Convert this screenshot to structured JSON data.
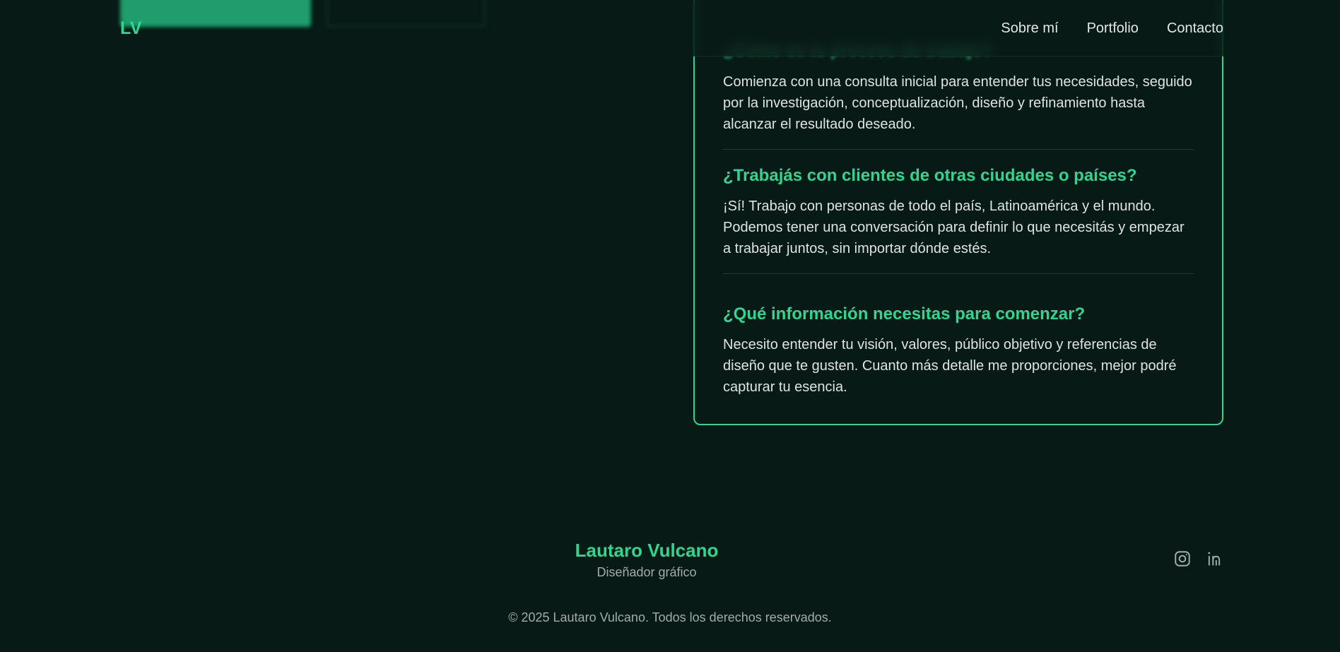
{
  "header": {
    "logo": "LV",
    "nav": [
      "Sobre mí",
      "Portfolio",
      "Contacto"
    ]
  },
  "faq": {
    "partial_question": "¿Cómo es tu proceso de trabajo?",
    "items": [
      {
        "answer": "Comienza con una consulta inicial para entender tus necesidades, seguido por la investigación, conceptualización, diseño y refinamiento hasta alcanzar el resultado deseado."
      },
      {
        "question": "¿Trabajás con clientes de otras ciudades o países?",
        "answer": "¡Sí! Trabajo con personas de todo el país, Latinoamérica y el mundo. Podemos tener una conversación para definir lo que necesitás y empezar a trabajar juntos, sin importar dónde estés."
      },
      {
        "question": "¿Qué información necesitas para comenzar?",
        "answer": "Necesito entender tu visión, valores, público objetivo y referencias de diseño que te gusten. Cuanto más detalle me proporciones, mejor podré capturar tu esencia."
      }
    ]
  },
  "footer": {
    "name": "Lautaro Vulcano",
    "role": "Diseñador gráfico",
    "socials": [
      "instagram-icon",
      "linkedin-icon"
    ],
    "copyright": "© 2025 Lautaro Vulcano. Todos los derechos reservados."
  },
  "colors": {
    "background": "#071a15",
    "accent": "#2fd692",
    "text": "#dfe3e1",
    "muted": "#a4acaa"
  }
}
